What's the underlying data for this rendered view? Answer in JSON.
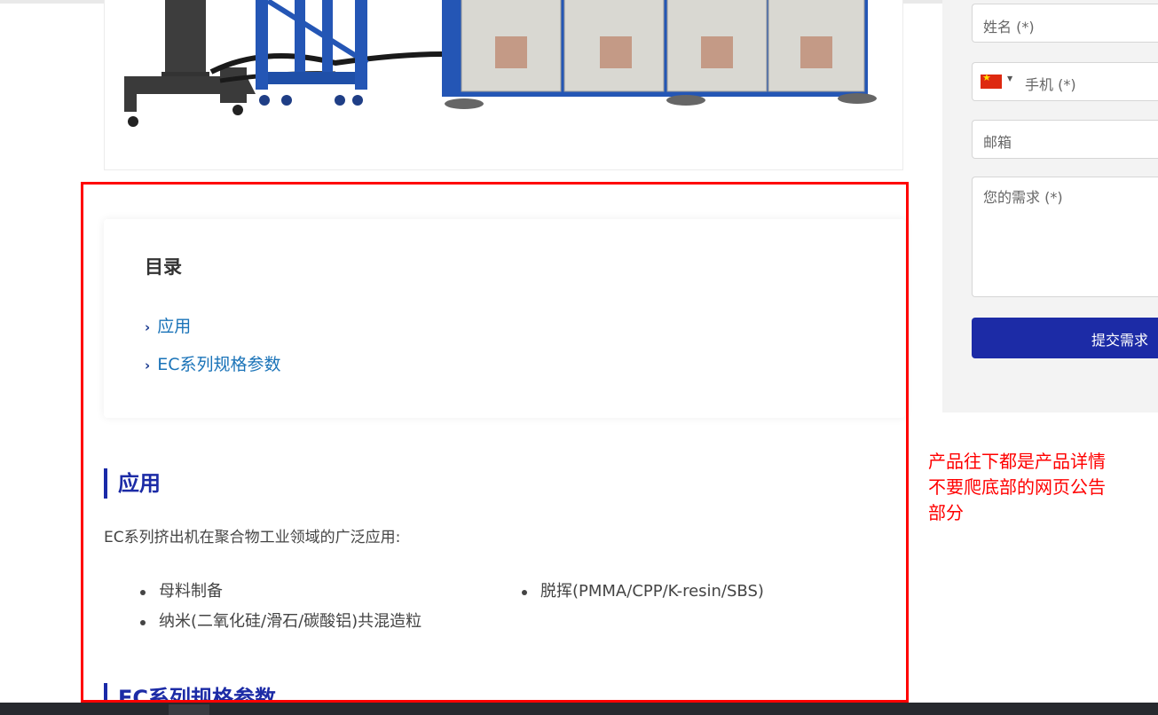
{
  "toc": {
    "title": "目录",
    "items": [
      "应用",
      "EC系列规格参数"
    ]
  },
  "sections": {
    "application": {
      "title": "应用",
      "intro": "EC系列挤出机在聚合物工业领域的广泛应用:",
      "bullets_left": [
        "母料制备",
        "纳米(二氧化硅/滑石/碳酸铝)共混造粒"
      ],
      "bullets_right": [
        "脱挥(PMMA/CPP/K-resin/SBS)"
      ]
    },
    "specs": {
      "title": "EC系列规格参数"
    }
  },
  "form": {
    "name_placeholder": "姓名 (*)",
    "phone_placeholder": "手机 (*)",
    "email_placeholder": "邮箱",
    "request_placeholder": "您的需求 (*)",
    "submit_label": "提交需求",
    "country_flag": "china-flag-icon"
  },
  "annotation": {
    "text": "产品往下都是产品详情\n不要爬底部的网页公告\n部分",
    "color": "#ff0000"
  },
  "colors": {
    "brand_blue": "#1c2ba6",
    "link_blue": "#1a73b8"
  }
}
